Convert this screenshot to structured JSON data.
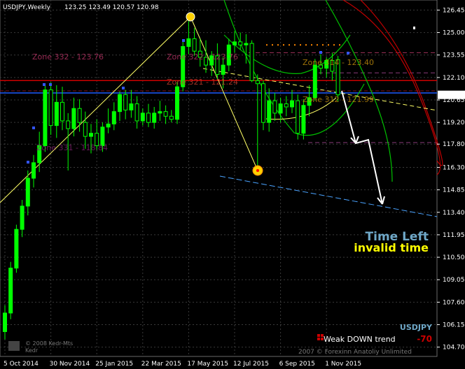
{
  "header": {
    "symbol_timeframe": "USDJPY,Weekly",
    "ohlc": "123.25 123.49 120.57 120.98"
  },
  "current_price": "120.98",
  "zones": [
    {
      "label": "Zone 332 - 123.76",
      "color": "#b03060"
    },
    {
      "label": "Zone 322 - 123.76",
      "color": "#b03060"
    },
    {
      "label": "Zone 321 - 121.24",
      "color": "#c0392b"
    },
    {
      "label": "Zone 314 - 123.40",
      "color": "#b8860b"
    },
    {
      "label": "Zone 312 - 121.99",
      "color": "#b8860b"
    },
    {
      "label": "Zone 331 - 118.84",
      "color": "#7a1f6a"
    }
  ],
  "time_left": {
    "title": "Time Left",
    "value": "invalid time"
  },
  "panel": {
    "symbol": "USDJPY",
    "trend": "Weak DOWN trend",
    "trend_value": "-70",
    "copyright": "2007 © Forexinn Anatoliy Unlimited"
  },
  "watermark": "© 2008 Kedr-Mts\nKedr",
  "colors": {
    "bull": "#00ff00",
    "bear": "#000000",
    "wick": "#00ff00",
    "grid": "#3a3a3a",
    "trend_white": "#ffffff",
    "channel_green": "#00c000",
    "channel_red": "#c00000",
    "channel_yellow": "#ffff66",
    "blue_line": "#1e5cff",
    "red_line": "#cc0000",
    "projection_blue": "#4aa3ff"
  },
  "chart_data": {
    "type": "candlestick",
    "x_ticks": [
      "5 Oct 2014",
      "30 Nov 2014",
      "25 Jan 2015",
      "22 Mar 2015",
      "17 May 2015",
      "12 Jul 2015",
      "6 Sep 2015",
      "1 Nov 2015"
    ],
    "y_ticks": [
      126.45,
      125.0,
      123.55,
      122.1,
      120.65,
      119.2,
      117.8,
      116.3,
      114.85,
      113.4,
      111.95,
      110.5,
      109.05,
      107.6,
      106.15,
      104.7
    ],
    "ylim": [
      104.1,
      127.1
    ],
    "candles": [
      {
        "o": 105.7,
        "h": 107.4,
        "l": 105.2,
        "c": 106.9
      },
      {
        "o": 106.9,
        "h": 110.2,
        "l": 106.5,
        "c": 109.8
      },
      {
        "o": 109.8,
        "h": 112.6,
        "l": 109.5,
        "c": 112.3
      },
      {
        "o": 112.3,
        "h": 114.2,
        "l": 111.8,
        "c": 113.8
      },
      {
        "o": 113.8,
        "h": 116.1,
        "l": 113.2,
        "c": 115.6
      },
      {
        "o": 115.6,
        "h": 117.1,
        "l": 115.0,
        "c": 116.6
      },
      {
        "o": 116.6,
        "h": 118.6,
        "l": 116.0,
        "c": 117.7
      },
      {
        "o": 117.7,
        "h": 121.7,
        "l": 117.3,
        "c": 121.3
      },
      {
        "o": 121.3,
        "h": 121.8,
        "l": 118.4,
        "c": 119.0
      },
      {
        "o": 119.0,
        "h": 121.6,
        "l": 118.2,
        "c": 120.5
      },
      {
        "o": 120.5,
        "h": 121.5,
        "l": 118.7,
        "c": 119.3
      },
      {
        "o": 119.3,
        "h": 119.8,
        "l": 116.1,
        "c": 118.8
      },
      {
        "o": 118.8,
        "h": 120.8,
        "l": 118.3,
        "c": 120.1
      },
      {
        "o": 120.1,
        "h": 120.7,
        "l": 118.6,
        "c": 119.2
      },
      {
        "o": 119.2,
        "h": 119.9,
        "l": 117.5,
        "c": 118.3
      },
      {
        "o": 118.3,
        "h": 119.1,
        "l": 117.2,
        "c": 118.5
      },
      {
        "o": 118.5,
        "h": 119.4,
        "l": 117.4,
        "c": 117.7
      },
      {
        "o": 117.7,
        "h": 119.2,
        "l": 117.3,
        "c": 118.9
      },
      {
        "o": 118.9,
        "h": 120.1,
        "l": 118.5,
        "c": 119.1
      },
      {
        "o": 119.1,
        "h": 120.5,
        "l": 118.7,
        "c": 119.9
      },
      {
        "o": 119.9,
        "h": 121.2,
        "l": 119.3,
        "c": 121.0
      },
      {
        "o": 121.0,
        "h": 121.3,
        "l": 119.4,
        "c": 120.0
      },
      {
        "o": 120.0,
        "h": 121.3,
        "l": 119.5,
        "c": 120.4
      },
      {
        "o": 120.4,
        "h": 120.9,
        "l": 118.8,
        "c": 119.3
      },
      {
        "o": 119.3,
        "h": 120.1,
        "l": 119.0,
        "c": 119.8
      },
      {
        "o": 119.8,
        "h": 120.4,
        "l": 118.9,
        "c": 119.2
      },
      {
        "o": 119.2,
        "h": 120.2,
        "l": 118.8,
        "c": 119.8
      },
      {
        "o": 119.8,
        "h": 120.6,
        "l": 119.3,
        "c": 119.9
      },
      {
        "o": 119.9,
        "h": 120.3,
        "l": 119.1,
        "c": 119.6
      },
      {
        "o": 119.6,
        "h": 120.0,
        "l": 119.2,
        "c": 119.4
      },
      {
        "o": 119.4,
        "h": 121.8,
        "l": 119.1,
        "c": 121.5
      },
      {
        "o": 121.5,
        "h": 124.5,
        "l": 121.2,
        "c": 124.1
      },
      {
        "o": 124.1,
        "h": 125.8,
        "l": 123.6,
        "c": 124.6
      },
      {
        "o": 124.6,
        "h": 125.3,
        "l": 123.5,
        "c": 123.8
      },
      {
        "o": 123.8,
        "h": 124.6,
        "l": 122.8,
        "c": 123.4
      },
      {
        "o": 123.4,
        "h": 124.5,
        "l": 122.4,
        "c": 122.9
      },
      {
        "o": 122.9,
        "h": 123.8,
        "l": 122.2,
        "c": 123.5
      },
      {
        "o": 123.5,
        "h": 124.3,
        "l": 122.0,
        "c": 122.3
      },
      {
        "o": 122.3,
        "h": 123.4,
        "l": 121.4,
        "c": 122.9
      },
      {
        "o": 122.9,
        "h": 124.6,
        "l": 122.5,
        "c": 124.2
      },
      {
        "o": 124.2,
        "h": 125.1,
        "l": 123.7,
        "c": 124.4
      },
      {
        "o": 124.4,
        "h": 125.0,
        "l": 123.9,
        "c": 124.2
      },
      {
        "o": 124.2,
        "h": 124.9,
        "l": 123.0,
        "c": 124.3
      },
      {
        "o": 124.3,
        "h": 124.5,
        "l": 121.8,
        "c": 121.9
      },
      {
        "o": 121.9,
        "h": 122.3,
        "l": 116.2,
        "c": 121.7
      },
      {
        "o": 121.7,
        "h": 121.9,
        "l": 118.7,
        "c": 119.2
      },
      {
        "o": 119.2,
        "h": 121.4,
        "l": 118.6,
        "c": 120.6
      },
      {
        "o": 120.6,
        "h": 121.1,
        "l": 119.3,
        "c": 119.8
      },
      {
        "o": 119.8,
        "h": 120.8,
        "l": 119.2,
        "c": 120.4
      },
      {
        "o": 120.4,
        "h": 120.9,
        "l": 119.6,
        "c": 120.2
      },
      {
        "o": 120.2,
        "h": 121.3,
        "l": 119.8,
        "c": 120.6
      },
      {
        "o": 120.6,
        "h": 121.0,
        "l": 118.1,
        "c": 118.5
      },
      {
        "o": 118.5,
        "h": 120.7,
        "l": 118.1,
        "c": 120.3
      },
      {
        "o": 120.3,
        "h": 121.6,
        "l": 119.6,
        "c": 120.8
      },
      {
        "o": 120.8,
        "h": 123.3,
        "l": 120.6,
        "c": 122.9
      },
      {
        "o": 122.9,
        "h": 123.6,
        "l": 122.3,
        "c": 122.7
      },
      {
        "o": 122.7,
        "h": 123.4,
        "l": 122.1,
        "c": 123.2
      },
      {
        "o": 123.2,
        "h": 123.7,
        "l": 121.9,
        "c": 122.5
      },
      {
        "o": 123.25,
        "h": 123.49,
        "l": 120.57,
        "c": 120.98
      }
    ]
  }
}
